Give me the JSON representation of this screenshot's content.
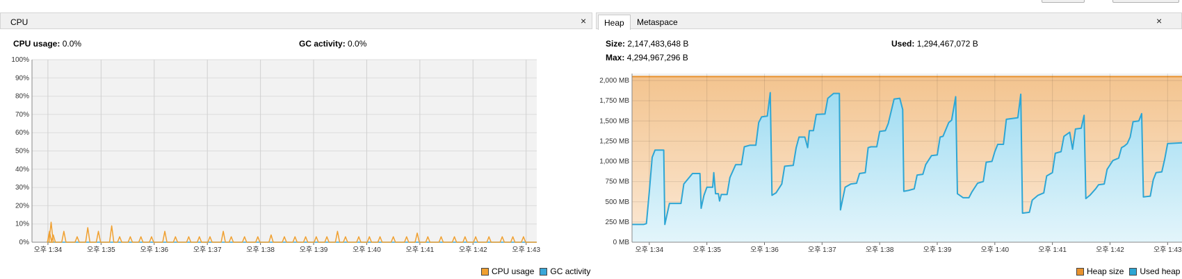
{
  "cpu_panel": {
    "tab_label": "CPU",
    "close_glyph": "×",
    "stats": {
      "cpu_usage_label": "CPU usage:",
      "cpu_usage_value": "0.0%",
      "gc_activity_label": "GC activity:",
      "gc_activity_value": "0.0%"
    },
    "legend": {
      "cpu_usage": "CPU usage",
      "gc_activity": "GC activity"
    },
    "colors": {
      "cpu": "#f0a030",
      "gc": "#3aa7d8"
    }
  },
  "heap_panel": {
    "tabs": [
      "Heap",
      "Metaspace"
    ],
    "close_glyph": "×",
    "stats": {
      "size_label": "Size:",
      "size_value": "2,147,483,648 B",
      "used_label": "Used:",
      "used_value": "1,294,467,072 B",
      "max_label": "Max:",
      "max_value": "4,294,967,296 B"
    },
    "legend": {
      "heap_size": "Heap size",
      "used_heap": "Used heap"
    },
    "colors": {
      "heap_size": "#e8922e",
      "used_heap": "#2ea6d4"
    }
  },
  "chart_data": [
    {
      "type": "line",
      "name": "cpu",
      "y_ticks": [
        "0%",
        "10%",
        "20%",
        "30%",
        "40%",
        "50%",
        "60%",
        "70%",
        "80%",
        "90%",
        "100%"
      ],
      "ylim": [
        0,
        100
      ],
      "x_ticks": [
        "오후 1:34",
        "오후 1:35",
        "오후 1:36",
        "오후 1:37",
        "오후 1:38",
        "오후 1:39",
        "오후 1:40",
        "오후 1:41",
        "오후 1:42",
        "오후 1:43"
      ],
      "x_tick_minutes": [
        0,
        1,
        2,
        3,
        4,
        5,
        6,
        7,
        8,
        9
      ],
      "xlim_minutes": [
        -0.3,
        9.2
      ],
      "series": [
        {
          "name": "CPU usage",
          "peaks": [
            [
              0.03,
              6
            ],
            [
              0.06,
              11
            ],
            [
              0.1,
              4
            ],
            [
              0.3,
              6
            ],
            [
              0.55,
              3
            ],
            [
              0.75,
              8
            ],
            [
              0.95,
              6
            ],
            [
              1.2,
              9
            ],
            [
              1.35,
              3
            ],
            [
              1.55,
              3
            ],
            [
              1.75,
              3
            ],
            [
              1.95,
              3
            ],
            [
              2.2,
              6
            ],
            [
              2.4,
              3
            ],
            [
              2.65,
              3
            ],
            [
              2.85,
              3
            ],
            [
              3.05,
              3
            ],
            [
              3.3,
              6
            ],
            [
              3.45,
              3
            ],
            [
              3.7,
              3
            ],
            [
              3.95,
              3
            ],
            [
              4.2,
              4
            ],
            [
              4.45,
              3
            ],
            [
              4.65,
              3
            ],
            [
              4.85,
              3
            ],
            [
              5.05,
              3
            ],
            [
              5.25,
              3
            ],
            [
              5.45,
              6
            ],
            [
              5.6,
              3
            ],
            [
              5.85,
              3
            ],
            [
              6.05,
              3
            ],
            [
              6.25,
              3
            ],
            [
              6.5,
              3
            ],
            [
              6.75,
              3
            ],
            [
              6.95,
              5
            ],
            [
              7.15,
              3
            ],
            [
              7.4,
              3
            ],
            [
              7.65,
              3
            ],
            [
              7.85,
              3
            ],
            [
              8.05,
              3
            ],
            [
              8.3,
              3
            ],
            [
              8.55,
              3
            ],
            [
              8.75,
              3
            ],
            [
              8.95,
              3
            ]
          ]
        },
        {
          "name": "GC activity",
          "value": 0
        }
      ]
    },
    {
      "type": "area",
      "name": "heap",
      "y_ticks": [
        "0 MB",
        "250 MB",
        "500 MB",
        "750 MB",
        "1,000 MB",
        "1,250 MB",
        "1,500 MB",
        "1,750 MB",
        "2,000 MB"
      ],
      "ylim_mb": [
        0,
        2000
      ],
      "x_ticks": [
        "오후 1:34",
        "오후 1:35",
        "오후 1:36",
        "오후 1:37",
        "오후 1:38",
        "오후 1:39",
        "오후 1:40",
        "오후 1:41",
        "오후 1:42",
        "오후 1:43"
      ],
      "x_tick_minutes": [
        0,
        1,
        2,
        3,
        4,
        5,
        6,
        7,
        8,
        9
      ],
      "xlim_minutes": [
        -0.3,
        9.25
      ],
      "series": [
        {
          "name": "Heap size",
          "value_mb": 2048
        },
        {
          "name": "Used heap",
          "points": [
            [
              -0.3,
              220
            ],
            [
              -0.1,
              220
            ],
            [
              -0.05,
              230
            ],
            [
              0.0,
              620
            ],
            [
              0.05,
              1050
            ],
            [
              0.1,
              1140
            ],
            [
              0.25,
              1140
            ],
            [
              0.27,
              220
            ],
            [
              0.35,
              480
            ],
            [
              0.55,
              480
            ],
            [
              0.6,
              720
            ],
            [
              0.75,
              850
            ],
            [
              0.88,
              850
            ],
            [
              0.9,
              420
            ],
            [
              0.95,
              580
            ],
            [
              1.0,
              680
            ],
            [
              1.1,
              680
            ],
            [
              1.12,
              860
            ],
            [
              1.15,
              600
            ],
            [
              1.2,
              600
            ],
            [
              1.22,
              510
            ],
            [
              1.25,
              590
            ],
            [
              1.35,
              590
            ],
            [
              1.4,
              800
            ],
            [
              1.5,
              960
            ],
            [
              1.6,
              960
            ],
            [
              1.65,
              1180
            ],
            [
              1.75,
              1200
            ],
            [
              1.85,
              1200
            ],
            [
              1.9,
              1480
            ],
            [
              1.95,
              1550
            ],
            [
              2.05,
              1560
            ],
            [
              2.1,
              1850
            ],
            [
              2.13,
              580
            ],
            [
              2.2,
              610
            ],
            [
              2.3,
              720
            ],
            [
              2.35,
              940
            ],
            [
              2.5,
              950
            ],
            [
              2.55,
              1170
            ],
            [
              2.6,
              1300
            ],
            [
              2.7,
              1300
            ],
            [
              2.75,
              1170
            ],
            [
              2.78,
              1380
            ],
            [
              2.85,
              1380
            ],
            [
              2.9,
              1580
            ],
            [
              3.05,
              1585
            ],
            [
              3.1,
              1780
            ],
            [
              3.2,
              1840
            ],
            [
              3.3,
              1840
            ],
            [
              3.32,
              400
            ],
            [
              3.4,
              680
            ],
            [
              3.5,
              720
            ],
            [
              3.6,
              730
            ],
            [
              3.65,
              850
            ],
            [
              3.75,
              860
            ],
            [
              3.8,
              1170
            ],
            [
              3.85,
              1180
            ],
            [
              3.95,
              1180
            ],
            [
              4.0,
              1370
            ],
            [
              4.1,
              1380
            ],
            [
              4.15,
              1470
            ],
            [
              4.25,
              1770
            ],
            [
              4.35,
              1780
            ],
            [
              4.4,
              1640
            ],
            [
              4.42,
              630
            ],
            [
              4.5,
              640
            ],
            [
              4.6,
              660
            ],
            [
              4.65,
              830
            ],
            [
              4.75,
              840
            ],
            [
              4.8,
              960
            ],
            [
              4.9,
              1070
            ],
            [
              5.0,
              1080
            ],
            [
              5.05,
              1300
            ],
            [
              5.1,
              1310
            ],
            [
              5.2,
              1480
            ],
            [
              5.25,
              1510
            ],
            [
              5.32,
              1800
            ],
            [
              5.35,
              600
            ],
            [
              5.45,
              550
            ],
            [
              5.55,
              550
            ],
            [
              5.6,
              620
            ],
            [
              5.7,
              730
            ],
            [
              5.8,
              750
            ],
            [
              5.85,
              990
            ],
            [
              5.95,
              1000
            ],
            [
              6.0,
              1120
            ],
            [
              6.05,
              1210
            ],
            [
              6.15,
              1210
            ],
            [
              6.2,
              1520
            ],
            [
              6.3,
              1530
            ],
            [
              6.4,
              1540
            ],
            [
              6.45,
              1830
            ],
            [
              6.48,
              360
            ],
            [
              6.6,
              370
            ],
            [
              6.65,
              520
            ],
            [
              6.75,
              580
            ],
            [
              6.85,
              610
            ],
            [
              6.9,
              820
            ],
            [
              7.0,
              860
            ],
            [
              7.05,
              1100
            ],
            [
              7.15,
              1120
            ],
            [
              7.2,
              1310
            ],
            [
              7.3,
              1360
            ],
            [
              7.35,
              1150
            ],
            [
              7.4,
              1400
            ],
            [
              7.5,
              1410
            ],
            [
              7.55,
              1570
            ],
            [
              7.58,
              540
            ],
            [
              7.65,
              580
            ],
            [
              7.75,
              660
            ],
            [
              7.8,
              710
            ],
            [
              7.9,
              720
            ],
            [
              7.95,
              900
            ],
            [
              8.05,
              1010
            ],
            [
              8.15,
              1040
            ],
            [
              8.2,
              1170
            ],
            [
              8.25,
              1190
            ],
            [
              8.3,
              1220
            ],
            [
              8.35,
              1300
            ],
            [
              8.4,
              1490
            ],
            [
              8.5,
              1500
            ],
            [
              8.55,
              1590
            ],
            [
              8.58,
              560
            ],
            [
              8.7,
              570
            ],
            [
              8.75,
              770
            ],
            [
              8.8,
              860
            ],
            [
              8.9,
              870
            ],
            [
              8.95,
              1030
            ],
            [
              9.0,
              1220
            ],
            [
              9.25,
              1230
            ]
          ]
        }
      ]
    }
  ]
}
